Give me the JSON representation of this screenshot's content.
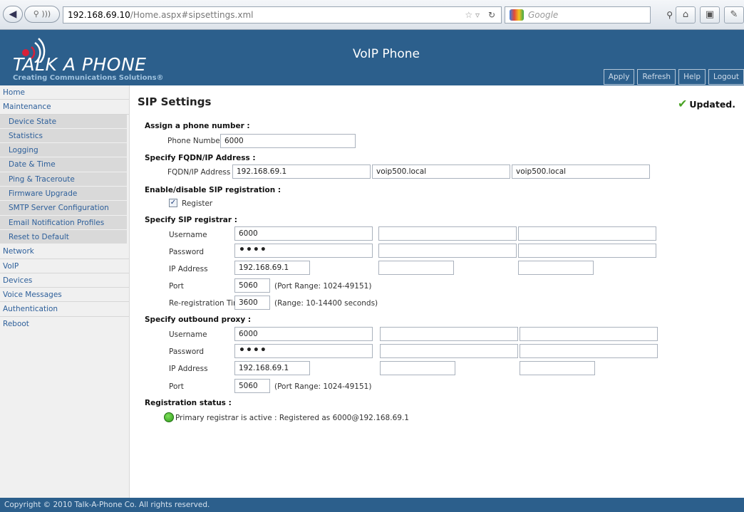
{
  "browser": {
    "url_host": "192.168.69.10",
    "url_path": "/Home.aspx#sipsettings.xml",
    "search_placeholder": "Google"
  },
  "header": {
    "brand": "TALK A PHONE",
    "tagline": "Creating Communications Solutions®",
    "title": "VoIP Phone",
    "buttons": [
      "Apply",
      "Refresh",
      "Help",
      "Logout"
    ]
  },
  "sidebar": {
    "items": [
      {
        "label": "Home"
      },
      {
        "label": "Maintenance"
      },
      {
        "label": "Device State"
      },
      {
        "label": "Statistics"
      },
      {
        "label": "Logging"
      },
      {
        "label": "Date & Time"
      },
      {
        "label": "Ping & Traceroute"
      },
      {
        "label": "Firmware Upgrade"
      },
      {
        "label": "SMTP Server Configuration"
      },
      {
        "label": "Email Notification Profiles"
      },
      {
        "label": "Reset to Default"
      },
      {
        "label": "Network"
      },
      {
        "label": "VoIP"
      },
      {
        "label": "Devices"
      },
      {
        "label": "Voice Messages"
      },
      {
        "label": "Authentication"
      },
      {
        "label": "Reboot"
      }
    ]
  },
  "main": {
    "title": "SIP Settings",
    "status": "Updated.",
    "assign": {
      "heading": "Assign a phone number :",
      "phone_label": "Phone Number",
      "phone_value": "6000"
    },
    "fqdn": {
      "heading": "Specify FQDN/IP Address :",
      "label": "FQDN/IP Address",
      "values": [
        "192.168.69.1",
        "voip500.local",
        "voip500.local"
      ]
    },
    "reg": {
      "heading": "Enable/disable SIP registration :",
      "register_label": "Register",
      "checked": true
    },
    "registrar": {
      "heading": "Specify SIP registrar :",
      "username_label": "Username",
      "username": "6000",
      "password_label": "Password",
      "password": "••••",
      "ip_label": "IP Address",
      "ip": "192.168.69.1",
      "port_label": "Port",
      "port": "5060",
      "port_range": "(Port Range: 1024-49151)",
      "rereg_label": "Re-registration Time",
      "rereg": "3600",
      "rereg_range": "(Range: 10-14400 seconds)"
    },
    "proxy": {
      "heading": "Specify outbound proxy :",
      "username_label": "Username",
      "username": "6000",
      "password_label": "Password",
      "password": "••••",
      "ip_label": "IP Address",
      "ip": "192.168.69.1",
      "port_label": "Port",
      "port": "5060",
      "port_range": "(Port Range: 1024-49151)"
    },
    "status_section": {
      "heading": "Registration status :",
      "text": "Primary registrar is active : Registered as 6000@192.168.69.1"
    }
  },
  "footer": {
    "text": "Copyright © 2010 Talk-A-Phone Co. All rights reserved."
  },
  "colors": {
    "header_bg": "#2c5f8c",
    "link": "#2d5f9a",
    "ok_green": "#4aa325"
  }
}
